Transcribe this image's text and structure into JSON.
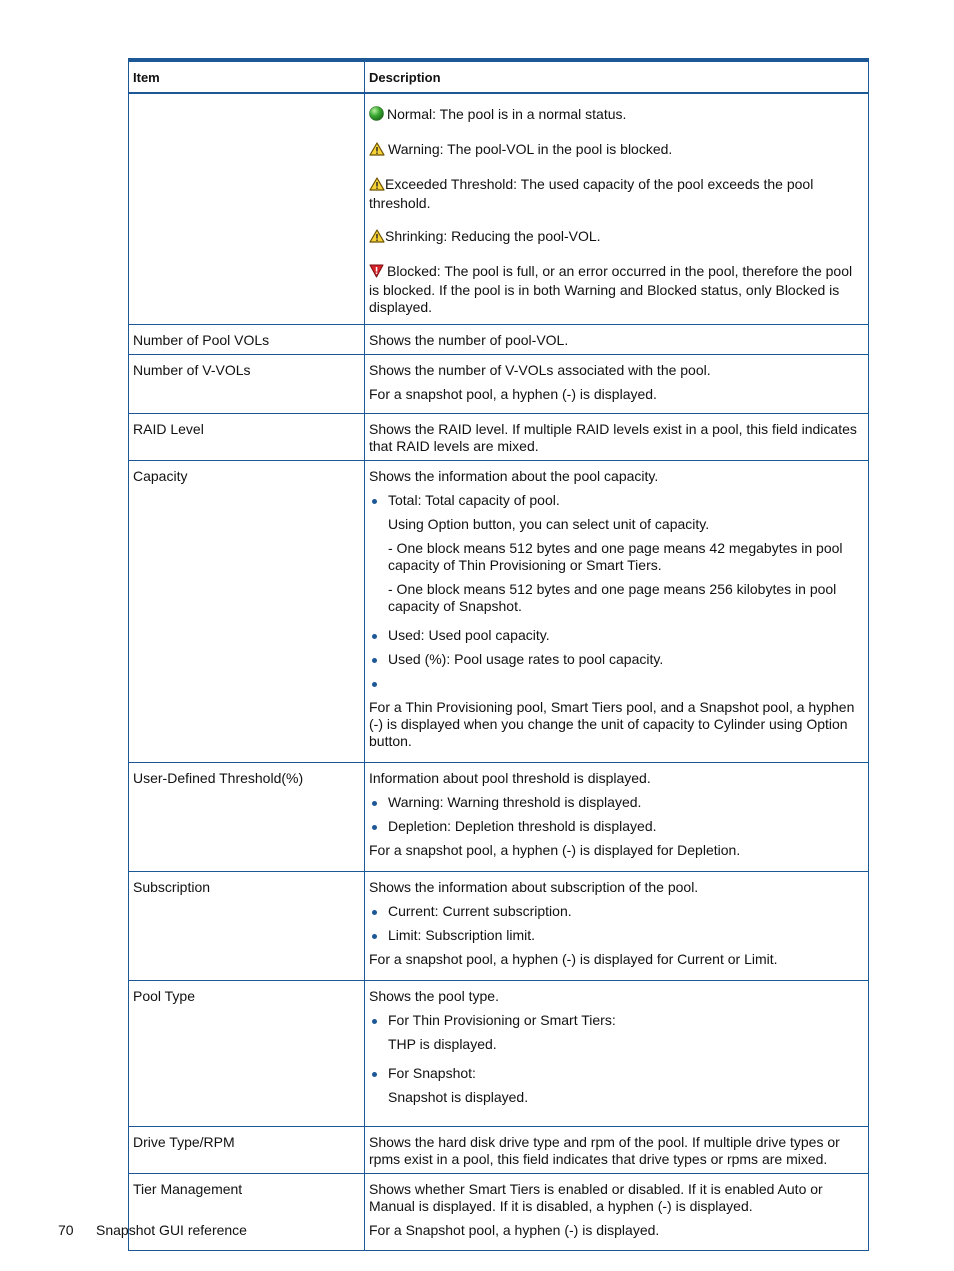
{
  "table": {
    "headers": [
      "Item",
      "Description"
    ],
    "status_rows": [
      {
        "icon": "normal-status-icon",
        "text": "Normal: The pool is in a normal status."
      },
      {
        "icon": "warning-icon",
        "text": "Warning: The pool-VOL in the pool is blocked."
      },
      {
        "icon": "warning-icon",
        "text": "Exceeded Threshold: The used capacity of the pool exceeds the pool threshold."
      },
      {
        "icon": "warning-icon",
        "text": "Shrinking: Reducing the pool-VOL."
      },
      {
        "icon": "blocked-icon",
        "text": "Blocked: The pool is full, or an error occurred in the pool, therefore the pool is blocked. If the pool is in both Warning and Blocked status, only Blocked is displayed."
      }
    ],
    "rows": [
      {
        "item": "Number of Pool VOLs",
        "desc": [
          "Shows the number of pool-VOL."
        ]
      },
      {
        "item": "Number of V-VOLs",
        "desc": [
          "Shows the number of V-VOLs associated with the pool.",
          "For a snapshot pool, a hyphen (-) is displayed."
        ]
      },
      {
        "item": "RAID Level",
        "desc": [
          "Shows the RAID level. If multiple RAID levels exist in a pool, this field indicates that RAID levels are mixed."
        ]
      },
      {
        "item": "Capacity",
        "intro": "Shows the information about the pool capacity.",
        "bullet_total": "Total: Total capacity of pool.",
        "total_note": "Using Option button, you can select unit of capacity.",
        "total_sub1": "- One block means 512 bytes and one page means 42 megabytes in pool capacity of Thin Provisioning or Smart Tiers.",
        "total_sub2": "- One block means 512 bytes and one page means 256 kilobytes in pool capacity of Snapshot.",
        "bullet_used": "Used: Used pool capacity.",
        "bullet_used_pct": "Used (%): Pool usage rates to pool capacity.",
        "bullet_empty": "",
        "note": "For a Thin Provisioning pool, Smart Tiers pool, and a Snapshot pool, a hyphen (-) is displayed when you change the unit of capacity to Cylinder using Option button."
      },
      {
        "item": "User-Defined Threshold(%)",
        "intro": "Information about pool threshold is displayed.",
        "bullets": [
          "Warning: Warning threshold is displayed.",
          "Depletion: Depletion threshold is displayed."
        ],
        "note": "For a snapshot pool, a hyphen (-) is displayed for Depletion."
      },
      {
        "item": "Subscription",
        "intro": "Shows the information about subscription of the pool.",
        "bullets": [
          "Current: Current subscription.",
          "Limit: Subscription limit."
        ],
        "note": "For a snapshot pool, a hyphen (-) is displayed for Current or Limit."
      },
      {
        "item": "Pool Type",
        "intro": "Shows the pool type.",
        "bullets": [
          "For Thin Provisioning or Smart Tiers:",
          "For Snapshot:"
        ],
        "subs": [
          "THP is displayed.",
          "Snapshot is displayed."
        ]
      },
      {
        "item": "Drive Type/RPM",
        "desc": [
          "Shows the hard disk drive type and rpm of the pool. If multiple drive types or rpms exist in a pool, this field indicates that drive types or rpms are mixed."
        ]
      },
      {
        "item": "Tier Management",
        "desc": [
          "Shows whether Smart Tiers is enabled or disabled. If it is enabled Auto or Manual is displayed. If it is disabled, a hyphen (-) is displayed.",
          "For a Snapshot pool, a hyphen (-) is displayed."
        ]
      }
    ]
  },
  "footer": {
    "page_number": "70",
    "section": "Snapshot GUI reference"
  }
}
